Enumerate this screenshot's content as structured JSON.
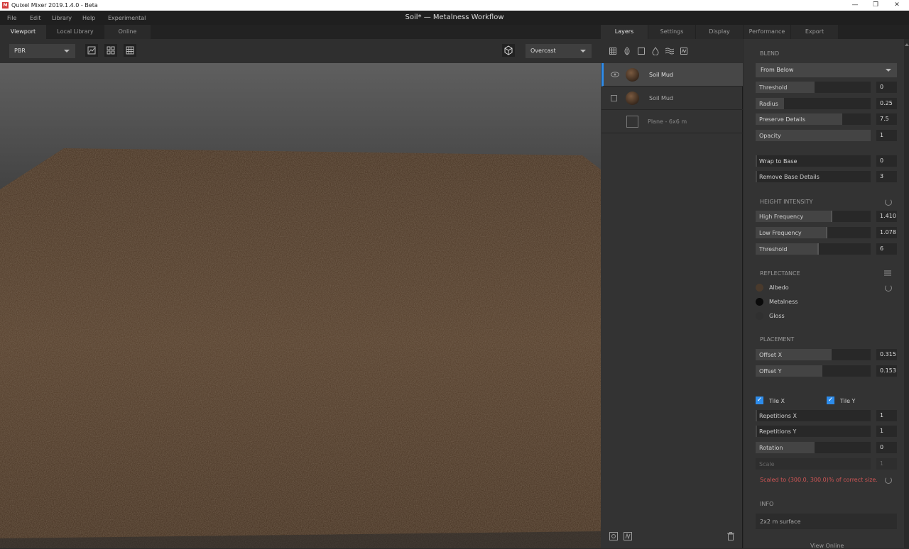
{
  "window": {
    "title": "Quixel Mixer 2019.1.4.0 - Beta",
    "logo": "M",
    "minimize": "—",
    "restore": "❐",
    "close": "✕"
  },
  "menu": [
    "File",
    "Edit",
    "Library",
    "Help",
    "Experimental"
  ],
  "document_title": "Soil* — Metalness Workflow",
  "left_tabs": [
    "Viewport",
    "Local Library",
    "Online"
  ],
  "viewport": {
    "render_mode": "PBR",
    "environment": "Overcast"
  },
  "right_tabs": [
    "Layers",
    "Settings",
    "Display",
    "Performance",
    "Export"
  ],
  "layers": [
    {
      "name": "Soil Mud",
      "visible": true,
      "selected": true
    },
    {
      "name": "Soil Mud",
      "visible": false,
      "selected": false
    },
    {
      "name": "Plane - 6x6 m",
      "visible": false,
      "selected": false
    }
  ],
  "blend": {
    "title": "BLEND",
    "mode": "From Below",
    "threshold": {
      "label": "Threshold",
      "value": "0",
      "fill": 0.5
    },
    "radius": {
      "label": "Radius",
      "value": "0.25",
      "fill": 0.25
    },
    "preserve_details": {
      "label": "Preserve Details",
      "value": "7.5",
      "fill": 0.75
    },
    "opacity": {
      "label": "Opacity",
      "value": "1",
      "fill": 1.0
    },
    "wrap_to_base": {
      "label": "Wrap to Base",
      "value": "0",
      "fill": 0.0
    },
    "remove_base_details": {
      "label": "Remove Base Details",
      "value": "3",
      "fill": 0.0
    }
  },
  "height": {
    "title": "HEIGHT INTENSITY",
    "high_frequency": {
      "label": "High Frequency",
      "value": "1.410",
      "fill": 0.68
    },
    "low_frequency": {
      "label": "Low Frequency",
      "value": "1.078",
      "fill": 0.63
    },
    "threshold": {
      "label": "Threshold",
      "value": "6",
      "fill": 0.55
    }
  },
  "reflectance": {
    "title": "REFLECTANCE",
    "albedo": {
      "label": "Albedo",
      "color": "#4a3a2c"
    },
    "metalness": {
      "label": "Metalness",
      "color": "#0a0a0a"
    },
    "gloss": {
      "label": "Gloss",
      "color": "#303030"
    }
  },
  "placement": {
    "title": "PLACEMENT",
    "offset_x": {
      "label": "Offset X",
      "value": "0.315",
      "fill": 0.66
    },
    "offset_y": {
      "label": "Offset Y",
      "value": "0.153",
      "fill": 0.58
    },
    "tile_x": "Tile X",
    "tile_y": "Tile Y",
    "check": "✓",
    "repetitions_x": {
      "label": "Repetitions X",
      "value": "1",
      "fill": 0.0
    },
    "repetitions_y": {
      "label": "Repetitions Y",
      "value": "1",
      "fill": 0.0
    },
    "rotation": {
      "label": "Rotation",
      "value": "0",
      "fill": 0.5
    },
    "scale": {
      "label": "Scale",
      "value": "1"
    },
    "warning": "Scaled to (300.0, 300.0)% of correct size."
  },
  "info": {
    "title": "INFO",
    "text": "2x2 m surface",
    "link": "View Online"
  },
  "colors": {
    "accent": "#2d8ceb",
    "warning": "#d05555"
  }
}
